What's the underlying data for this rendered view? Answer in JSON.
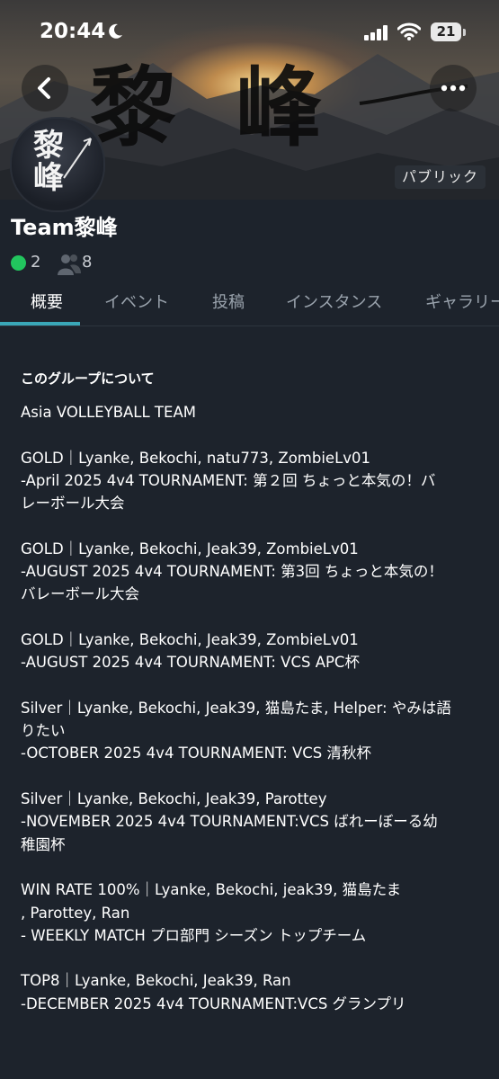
{
  "status_bar": {
    "time": "20:44",
    "battery": "21",
    "icons": [
      "moon-icon",
      "signal-icon",
      "wifi-icon",
      "battery-icon"
    ]
  },
  "banner": {
    "title": "黎峰",
    "avatar_text": "黎峰",
    "badge": "パブリック",
    "icons": [
      "back-icon",
      "more-icon"
    ]
  },
  "group": {
    "name": "Team黎峰",
    "online_count": "2",
    "member_count": "8",
    "online_color": "#22c55e"
  },
  "tabs": [
    {
      "label": "概要",
      "active": true
    },
    {
      "label": "イベント",
      "active": false
    },
    {
      "label": "投稿",
      "active": false
    },
    {
      "label": "インスタンス",
      "active": false
    },
    {
      "label": "ギャラリー",
      "active": false
    }
  ],
  "accent_color": "#3aa7b8",
  "about": {
    "heading": "このグループについて",
    "lines": [
      "Asia VOLLEYBALL TEAM",
      "",
      "GOLD｜Lyanke, Bekochi, natu773, ZombieLv01",
      "-April 2025 4v4 TOURNAMENT: 第２回 ちょっと本気の！バ",
      "レーボール大会",
      "",
      "GOLD｜Lyanke, Bekochi, Jeak39, ZombieLv01",
      "-AUGUST 2025 4v4 TOURNAMENT: 第3回 ちょっと本気の！",
      "バレーボール大会",
      "",
      "GOLD｜Lyanke, Bekochi, Jeak39, ZombieLv01",
      "-AUGUST 2025 4v4 TOURNAMENT: VCS APC杯",
      "",
      "Silver｜Lyanke, Bekochi, Jeak39, 猫島たま, Helper: やみは語",
      "りたい",
      "-OCTOBER 2025 4v4 TOURNAMENT: VCS 清秋杯",
      "",
      "Silver｜Lyanke, Bekochi, Jeak39, Parottey",
      "-NOVEMBER 2025 4v4 TOURNAMENT:VCS ばれーぼーる幼",
      "稚園杯",
      "",
      "WIN RATE 100%｜Lyanke, Bekochi, jeak39, 猫島たま",
      ", Parottey, Ran",
      "- WEEKLY MATCH プロ部門 シーズン トップチーム",
      "",
      "TOP8｜Lyanke, Bekochi, Jeak39, Ran",
      "-DECEMBER 2025 4v4 TOURNAMENT:VCS グランプリ"
    ]
  }
}
